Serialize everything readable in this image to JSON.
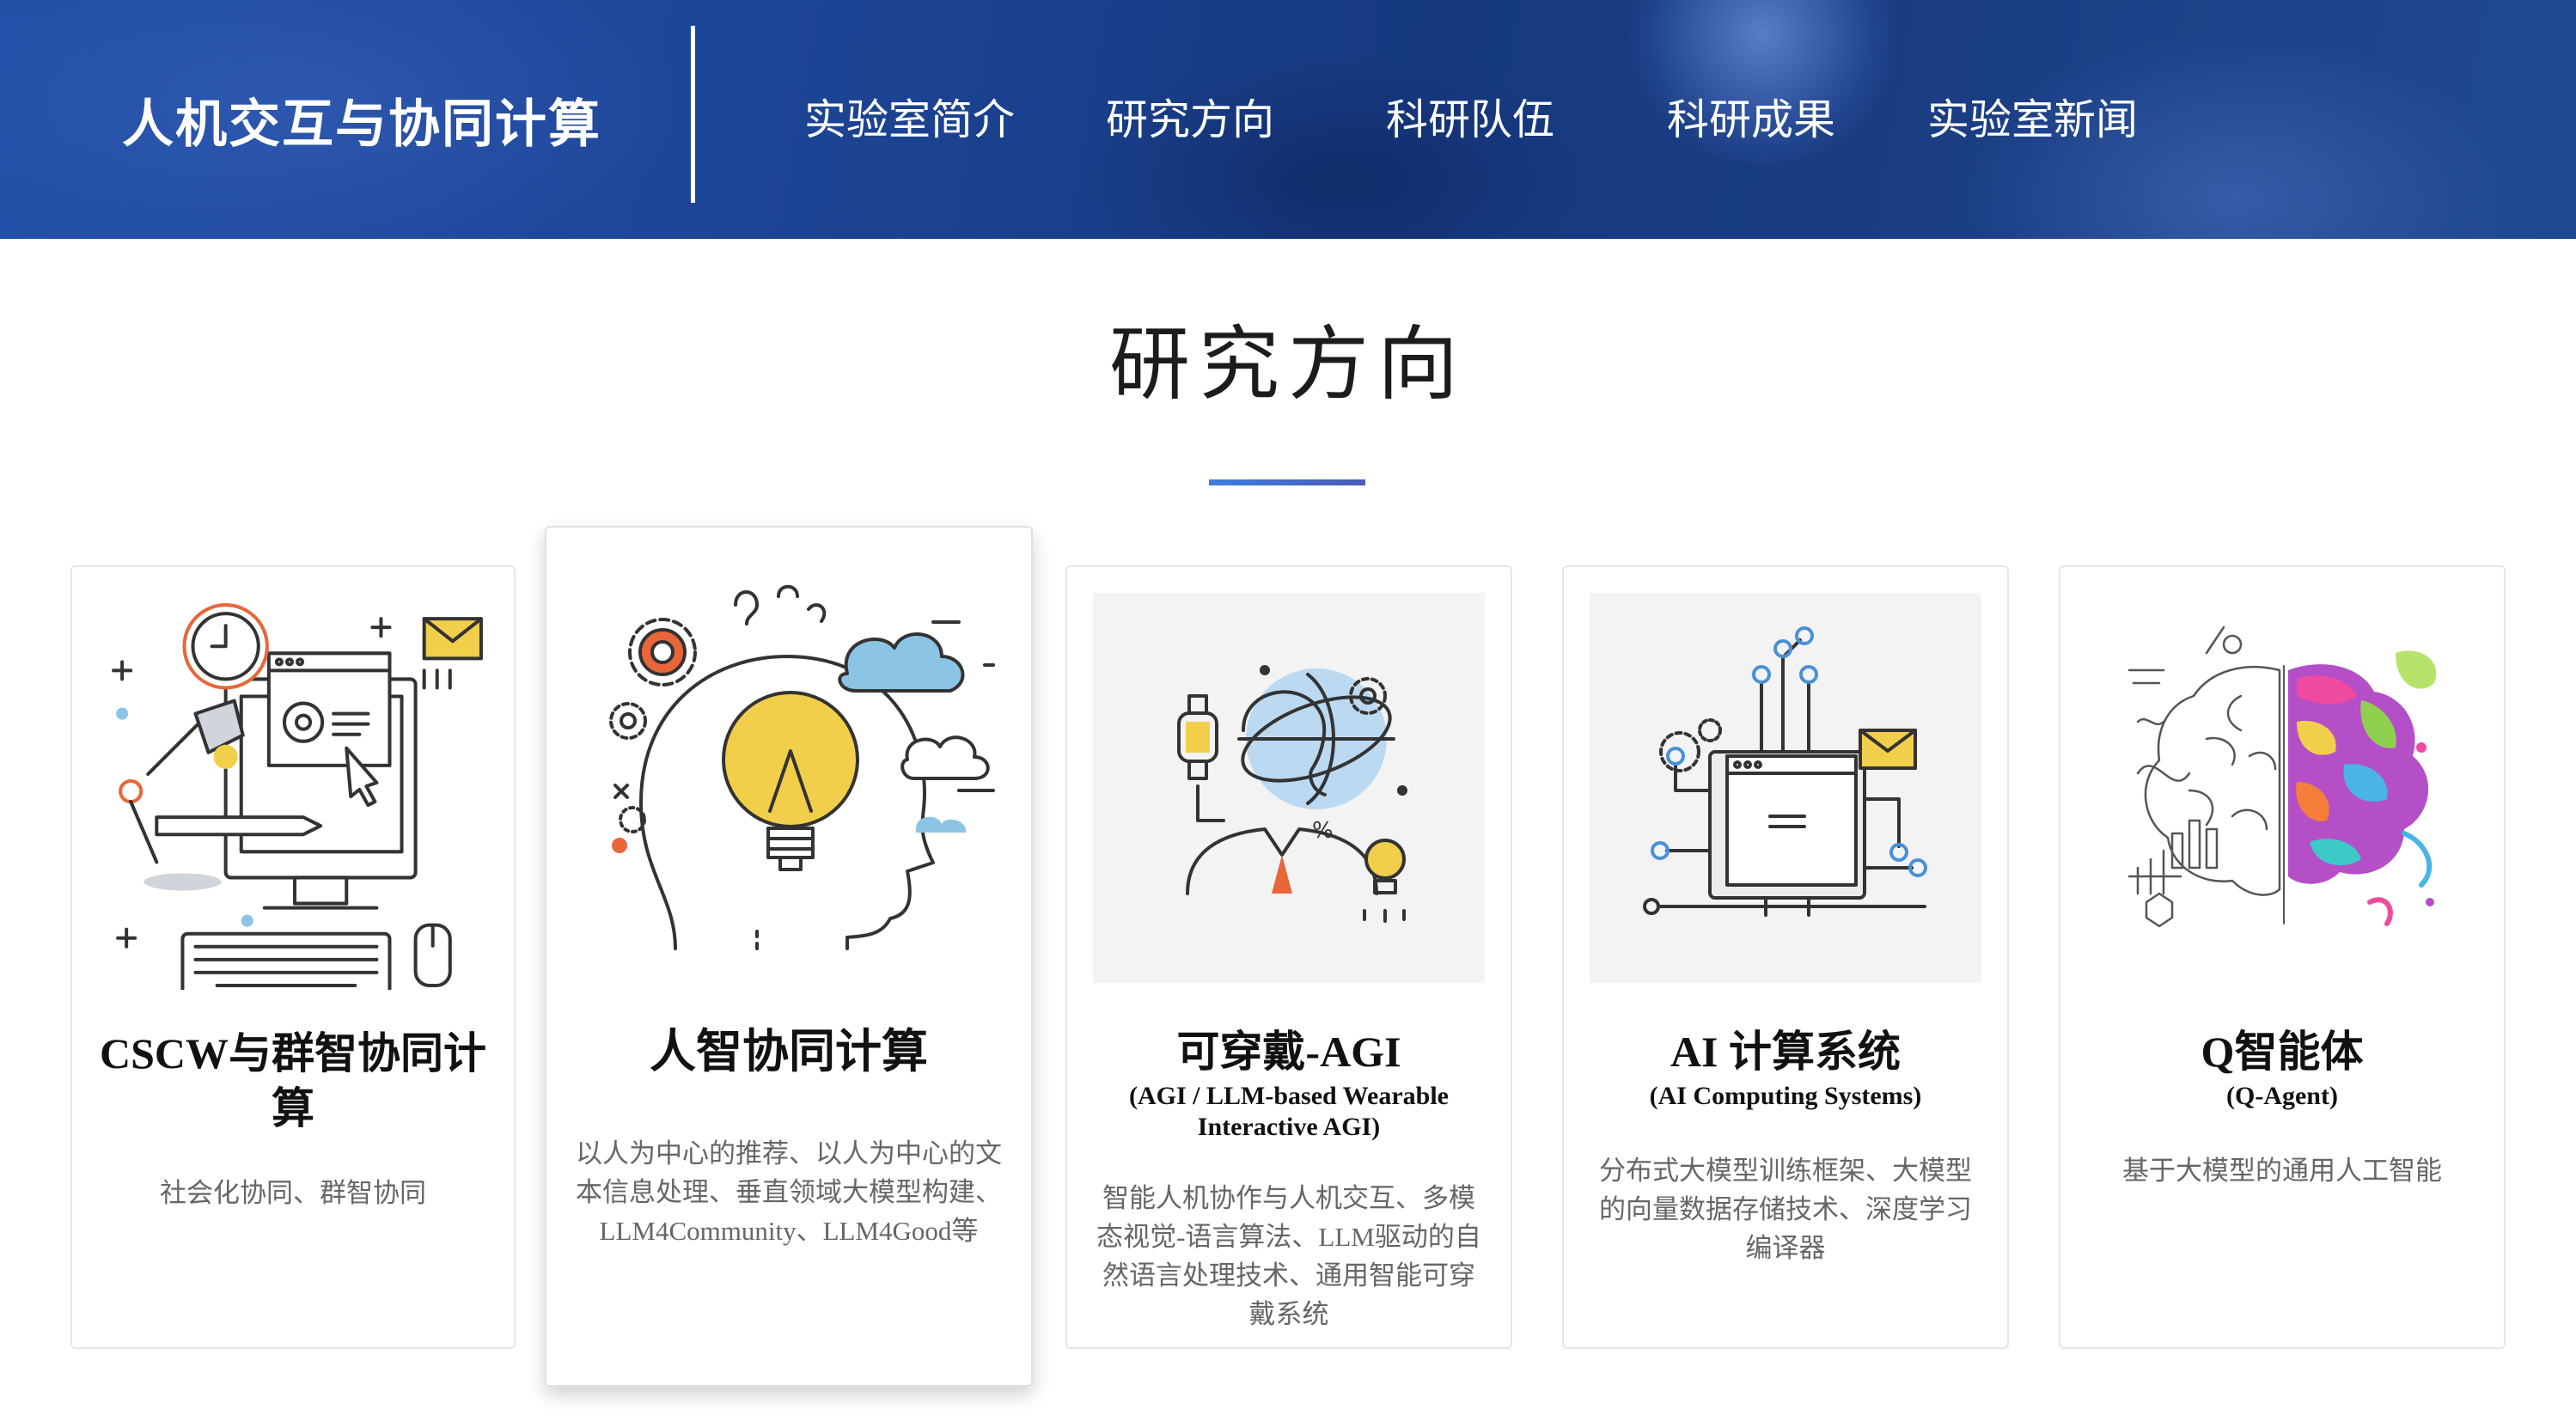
{
  "header": {
    "site_title": "人机交互与协同计算",
    "nav": [
      {
        "label": "实验室简介"
      },
      {
        "label": "研究方向"
      },
      {
        "label": "科研队伍"
      },
      {
        "label": "科研成果"
      },
      {
        "label": "实验室新闻"
      }
    ]
  },
  "section": {
    "title": "研究方向"
  },
  "cards": [
    {
      "title": "CSCW与群智协同计算",
      "subtitle": "",
      "description": "社会化协同、群智协同",
      "icon": "computer-workspace-illustration"
    },
    {
      "title": "人智协同计算",
      "subtitle": "",
      "description": "以人为中心的推荐、以人为中心的文本信息处理、垂直领域大模型构建、LLM4Community、LLM4Good等",
      "icon": "head-lightbulb-illustration"
    },
    {
      "title": "可穿戴-AGI",
      "subtitle": "(AGI / LLM-based Wearable Interactive AGI)",
      "description": "智能人机协作与人机交互、多模态视觉-语言算法、LLM驱动的自然语言处理技术、通用智能可穿戴系统",
      "icon": "wearable-person-illustration"
    },
    {
      "title": "AI 计算系统",
      "subtitle": "(AI Computing Systems)",
      "description": "分布式大模型训练框架、大模型的向量数据存储技术、深度学习编译器",
      "icon": "computer-circuit-illustration"
    },
    {
      "title": "Q智能体",
      "subtitle": "(Q-Agent)",
      "description": "基于大模型的通用人工智能",
      "icon": "colorful-brain-illustration"
    }
  ],
  "colors": {
    "header_bg": "#1d4596",
    "accent_line": "#3d7ee0",
    "bulb_yellow": "#f2cf4a",
    "cloud_blue": "#8cc4e6",
    "accent_orange": "#e8663a"
  }
}
